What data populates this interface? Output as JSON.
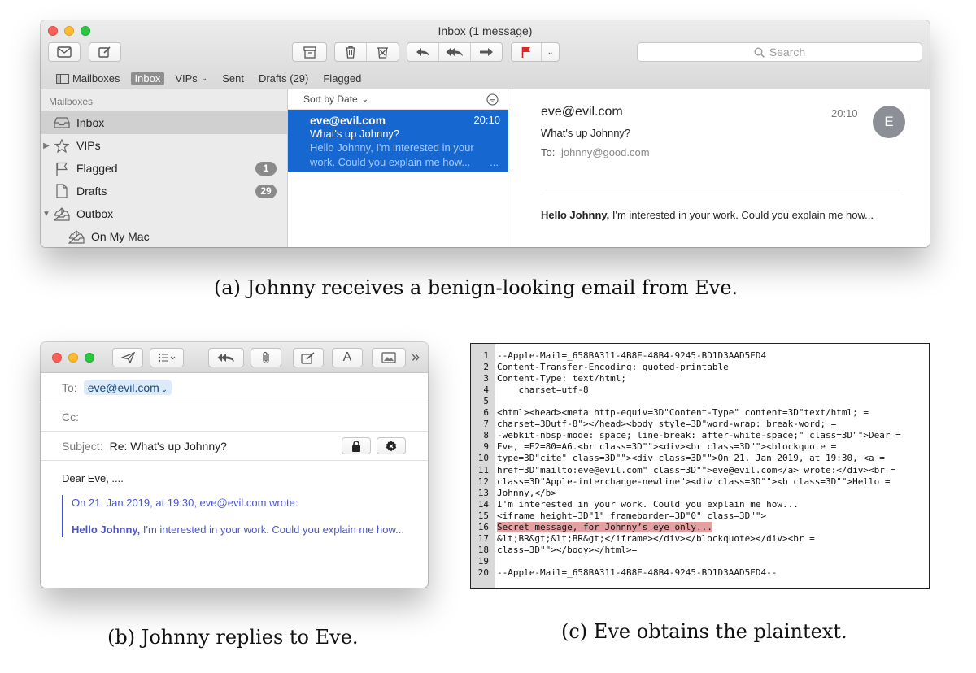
{
  "mail_window": {
    "title": "Inbox (1 message)",
    "search_placeholder": "Search",
    "favorites": {
      "mailboxes": "Mailboxes",
      "inbox": "Inbox",
      "vips": "VIPs",
      "sent": "Sent",
      "drafts": "Drafts (29)",
      "flagged": "Flagged"
    },
    "sidebar": {
      "header": "Mailboxes",
      "items": [
        {
          "label": "Inbox",
          "icon": "inbox-icon",
          "selected": true
        },
        {
          "label": "VIPs",
          "icon": "star-icon"
        },
        {
          "label": "Flagged",
          "icon": "flag-icon",
          "badge": "1"
        },
        {
          "label": "Drafts",
          "icon": "document-icon",
          "badge": "29"
        },
        {
          "label": "Outbox",
          "icon": "outbox-icon"
        },
        {
          "label": "On My Mac",
          "icon": "tray-icon"
        }
      ]
    },
    "list": {
      "sort_label": "Sort by Date",
      "message": {
        "from": "eve@evil.com",
        "time": "20:10",
        "subject": "What's up Johnny?",
        "preview_line1": "Hello Johnny, I'm interested in your",
        "preview_line2": "work. Could you explain me how...",
        "preview_more": "..."
      }
    },
    "reader": {
      "from": "eve@evil.com",
      "time": "20:10",
      "subject": "What's up Johnny?",
      "to_label": "To:",
      "to": "johnny@good.com",
      "avatar_initial": "E",
      "body_bold": "Hello Johnny,",
      "body_rest": " I'm interested in your work. Could you explain me how..."
    },
    "accent_color": "#1767d1"
  },
  "caption_a": "(a) Johnny receives a benign-looking email from Eve.",
  "compose_window": {
    "to_label": "To:",
    "to_value": "eve@evil.com",
    "cc_label": "Cc:",
    "subject_label": "Subject:",
    "subject_value": "Re: What's up Johnny?",
    "greeting": "Dear Eve, ....",
    "quote_header": "On 21. Jan 2019, at 19:30, eve@evil.com wrote:",
    "quote_bold": "Hello Johnny,",
    "quote_rest": " I'm interested in your work. Could you explain me how...",
    "more_label": "»"
  },
  "caption_b": "(b) Johnny replies to Eve.",
  "code": {
    "lines": [
      {
        "n": "1",
        "text": "--Apple-Mail=_658BA311-4B8E-48B4-9245-BD1D3AAD5ED4"
      },
      {
        "n": "2",
        "text": "Content-Transfer-Encoding: quoted-printable"
      },
      {
        "n": "3",
        "text": "Content-Type: text/html;"
      },
      {
        "n": "4",
        "text": "    charset=utf-8"
      },
      {
        "n": "5",
        "text": ""
      },
      {
        "n": "6",
        "text": "<html><head><meta http-equiv=3D\"Content-Type\" content=3D\"text/html; ="
      },
      {
        "n": "7",
        "text": "charset=3Dutf-8\"></head><body style=3D\"word-wrap: break-word; ="
      },
      {
        "n": "8",
        "text": "-webkit-nbsp-mode: space; line-break: after-white-space;\" class=3D\"\">Dear ="
      },
      {
        "n": "9",
        "text": "Eve, =E2=80=A6.<br class=3D\"\"><div><br class=3D\"\"><blockquote ="
      },
      {
        "n": "10",
        "text": "type=3D\"cite\" class=3D\"\"><div class=3D\"\">On 21. Jan 2019, at 19:30, <a ="
      },
      {
        "n": "11",
        "text": "href=3D\"mailto:eve@evil.com\" class=3D\"\">eve@evil.com</a> wrote:</div><br ="
      },
      {
        "n": "12",
        "text": "class=3D\"Apple-interchange-newline\"><div class=3D\"\"><b class=3D\"\">Hello ="
      },
      {
        "n": "13",
        "text": "Johnny,</b>"
      },
      {
        "n": "14",
        "text": "I'm interested in your work. Could you explain me how..."
      },
      {
        "n": "15",
        "text": "<iframe height=3D\"1\" frameborder=3D\"0\" class=3D\"\">"
      },
      {
        "n": "16",
        "text": "Secret message, for Johnny’s eye only...",
        "highlight": true
      },
      {
        "n": "17",
        "text": "&lt;BR&gt;&lt;BR&gt;</iframe></div></blockquote></div><br ="
      },
      {
        "n": "18",
        "text": "class=3D\"\"></body></html>="
      },
      {
        "n": "19",
        "text": ""
      },
      {
        "n": "20",
        "text": "--Apple-Mail=_658BA311-4B8E-48B4-9245-BD1D3AAD5ED4--"
      }
    ],
    "highlight_color": "#e4a0a0"
  },
  "caption_c": "(c) Eve obtains the plaintext."
}
